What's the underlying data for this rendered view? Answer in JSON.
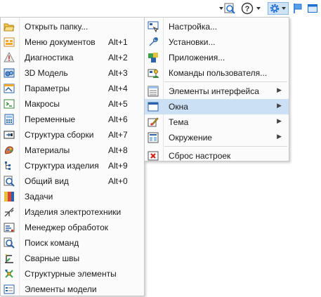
{
  "toolbar": {
    "buttons": [
      {
        "icon": "dropdown-search-icon"
      },
      {
        "icon": "help-icon"
      },
      {
        "icon": "gear-icon"
      },
      {
        "icon": "flag-icon"
      },
      {
        "icon": "window-icon"
      }
    ]
  },
  "left_menu": {
    "items": [
      {
        "label": "Открыть папку...",
        "shortcut": "",
        "icon": "folder-open-icon"
      },
      {
        "label": "Меню документов",
        "shortcut": "Alt+1",
        "icon": "documents-menu-icon"
      },
      {
        "label": "Диагностика",
        "shortcut": "Alt+2",
        "icon": "warning-icon"
      },
      {
        "label": "3D Модель",
        "shortcut": "Alt+3",
        "icon": "model-3d-icon"
      },
      {
        "label": "Параметры",
        "shortcut": "Alt+4",
        "icon": "parameters-icon"
      },
      {
        "label": "Макросы",
        "shortcut": "Alt+5",
        "icon": "macros-icon"
      },
      {
        "label": "Переменные",
        "shortcut": "Alt+6",
        "icon": "variables-icon"
      },
      {
        "label": "Структура сборки",
        "shortcut": "Alt+7",
        "icon": "assembly-structure-icon"
      },
      {
        "label": "Материалы",
        "shortcut": "Alt+8",
        "icon": "materials-icon"
      },
      {
        "label": "Структура изделия",
        "shortcut": "Alt+9",
        "icon": "product-structure-icon"
      },
      {
        "label": "Общий вид",
        "shortcut": "Alt+0",
        "icon": "general-view-icon"
      },
      {
        "label": "Задачи",
        "shortcut": "",
        "icon": "tasks-icon"
      },
      {
        "label": "Изделия электротехники",
        "shortcut": "",
        "icon": "electrical-icon"
      },
      {
        "label": "Менеджер обработок",
        "shortcut": "",
        "icon": "processing-manager-icon"
      },
      {
        "label": "Поиск команд",
        "shortcut": "",
        "icon": "command-search-icon"
      },
      {
        "label": "Сварные швы",
        "shortcut": "",
        "icon": "welds-icon"
      },
      {
        "label": "Структурные элементы",
        "shortcut": "",
        "icon": "structural-elements-icon"
      },
      {
        "label": "Элементы модели",
        "shortcut": "",
        "icon": "model-elements-icon"
      }
    ]
  },
  "right_menu": {
    "items": [
      {
        "label": "Настройка...",
        "icon": "customize-icon",
        "submenu": false
      },
      {
        "label": "Установки...",
        "icon": "wrench-icon",
        "submenu": false
      },
      {
        "label": "Приложения...",
        "icon": "applications-icon",
        "submenu": false
      },
      {
        "label": "Команды пользователя...",
        "icon": "user-commands-icon",
        "submenu": false
      },
      {
        "label": "Элементы интерфейса",
        "icon": "interface-elements-icon",
        "submenu": true
      },
      {
        "label": "Окна",
        "icon": "windows-icon",
        "submenu": true,
        "highlighted": true
      },
      {
        "label": "Тема",
        "icon": "theme-icon",
        "submenu": true
      },
      {
        "label": "Окружение",
        "icon": "environment-icon",
        "submenu": true
      },
      {
        "label": "Сброс настроек",
        "icon": "reset-icon",
        "submenu": false
      }
    ]
  },
  "colors": {
    "highlight": "#cce0f5",
    "accent": "#1f6fd0"
  }
}
